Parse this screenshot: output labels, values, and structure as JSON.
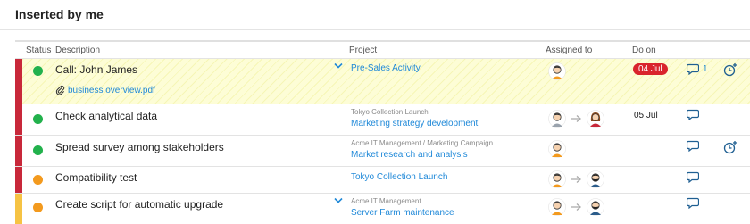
{
  "section": {
    "title": "Inserted by me"
  },
  "columns": {
    "status": "Status",
    "description": "Description",
    "project": "Project",
    "assigned": "Assigned to",
    "due": "Do on"
  },
  "colors": {
    "accent": "#1e88d8",
    "high_priority": "#c8283a",
    "medium_priority": "#f6c344",
    "done": "#22b14c",
    "in_progress": "#f39a1e",
    "overdue": "#d9242c"
  },
  "rows": [
    {
      "priority": "high",
      "status": "done",
      "description": "Call: John James",
      "attachment": "business overview.pdf",
      "project_parent": "",
      "project": "Pre-Sales Activity",
      "has_expand": true,
      "assigned": [
        "avatar-man"
      ],
      "due": "04 Jul",
      "overdue": true,
      "comments": "1",
      "highlighted": true,
      "has_reminder": true
    },
    {
      "priority": "high",
      "status": "done",
      "description": "Check analytical data",
      "project_parent": "Tokyo Collection Launch",
      "project": "Marketing strategy development",
      "assigned": [
        "avatar-man-2",
        "avatar-woman"
      ],
      "due": "05 Jul",
      "overdue": false,
      "comments": "",
      "has_reminder": false
    },
    {
      "priority": "high",
      "status": "done",
      "description": "Spread survey among stakeholders",
      "project_parent": "Acme IT Management / Marketing Campaign",
      "project": "Market research and analysis",
      "assigned": [
        "avatar-man"
      ],
      "due": "",
      "comments": "",
      "has_reminder": true
    },
    {
      "priority": "high",
      "status": "in_progress",
      "description": "Compatibility test",
      "project_parent": "",
      "project": "Tokyo Collection Launch",
      "assigned": [
        "avatar-man",
        "avatar-bearded-man"
      ],
      "due": "",
      "comments": "",
      "has_reminder": false
    },
    {
      "priority": "medium",
      "status": "in_progress",
      "description": "Create script for automatic upgrade",
      "project_parent": "Acme IT Management",
      "project": "Server Farm maintenance",
      "has_expand": true,
      "assigned": [
        "avatar-man",
        "avatar-bearded-man"
      ],
      "due": "",
      "comments": "",
      "has_reminder": false
    }
  ]
}
